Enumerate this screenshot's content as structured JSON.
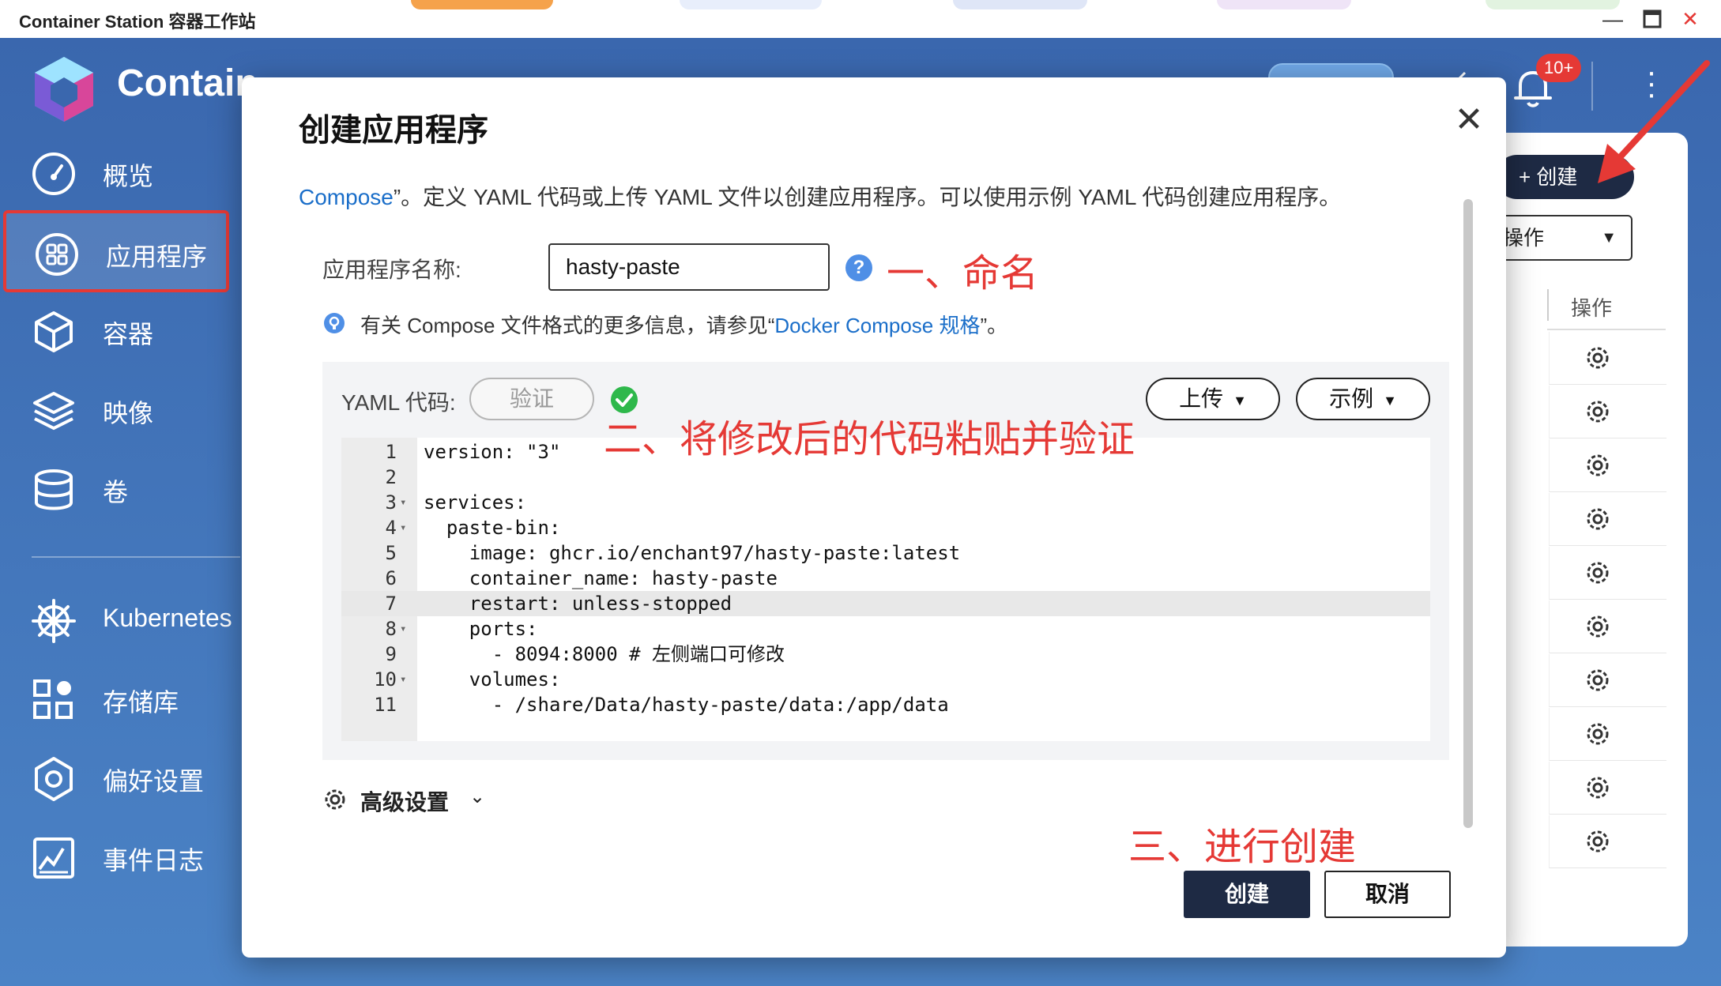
{
  "window": {
    "title": "Container Station 容器工作站",
    "minimize_icon": "minimize-icon",
    "maximize_icon": "maximize-icon",
    "close_icon": "close-icon"
  },
  "app": {
    "name": "Contain",
    "notifications_badge": "10+"
  },
  "sidebar": {
    "items": [
      {
        "label": "概览",
        "icon": "dashboard-icon"
      },
      {
        "label": "应用程序",
        "icon": "apps-icon"
      },
      {
        "label": "容器",
        "icon": "cube-icon"
      },
      {
        "label": "映像",
        "icon": "layers-icon"
      },
      {
        "label": "卷",
        "icon": "database-icon"
      },
      {
        "label": "Kubernetes",
        "icon": "helm-icon"
      },
      {
        "label": "存储库",
        "icon": "repository-icon"
      },
      {
        "label": "偏好设置",
        "icon": "settings-icon"
      },
      {
        "label": "事件日志",
        "icon": "event-log-icon"
      }
    ]
  },
  "background_panel": {
    "create_label": "+ 创建",
    "actions_select": "操作",
    "column_header": "操作",
    "row_count": 10
  },
  "modal": {
    "title": "创建应用程序",
    "description_link": "Compose",
    "description": "”。定义 YAML 代码或上传 YAML 文件以创建应用程序。可以使用示例 YAML 代码创建应用程序。",
    "name_label": "应用程序名称:",
    "name_value": "hasty-paste",
    "info_prefix": "有关 Compose 文件格式的更多信息，请参见“",
    "info_link": "Docker Compose 规格",
    "info_suffix": "”。",
    "yaml_label": "YAML 代码:",
    "verify_label": "验证",
    "upload_label": "上传",
    "example_label": "示例",
    "advanced_label": "高级设置",
    "create_label": "创建",
    "cancel_label": "取消"
  },
  "yaml_lines": [
    {
      "n": "1",
      "text": "version: \"3\""
    },
    {
      "n": "2",
      "text": ""
    },
    {
      "n": "3",
      "text": "services:"
    },
    {
      "n": "4",
      "text": "  paste-bin:"
    },
    {
      "n": "5",
      "text": "    image: ghcr.io/enchant97/hasty-paste:latest"
    },
    {
      "n": "6",
      "text": "    container_name: hasty-paste"
    },
    {
      "n": "7",
      "text": "    restart: unless-stopped"
    },
    {
      "n": "8",
      "text": "    ports:"
    },
    {
      "n": "9",
      "text": "      - 8094:8000 # 左侧端口可修改"
    },
    {
      "n": "10",
      "text": "    volumes:"
    },
    {
      "n": "11",
      "text": "      - /share/Data/hasty-paste/data:/app/data"
    }
  ],
  "annotations": {
    "step1": "一、命名",
    "step2": "二、将修改后的代码粘贴并验证",
    "step3": "三、进行创建"
  },
  "colors": {
    "sidebar_bg": "#3f73b8",
    "primary_dark": "#1e2a44",
    "link": "#1a6ec9",
    "annotation_red": "#e53935",
    "success_green": "#2eb84b"
  }
}
